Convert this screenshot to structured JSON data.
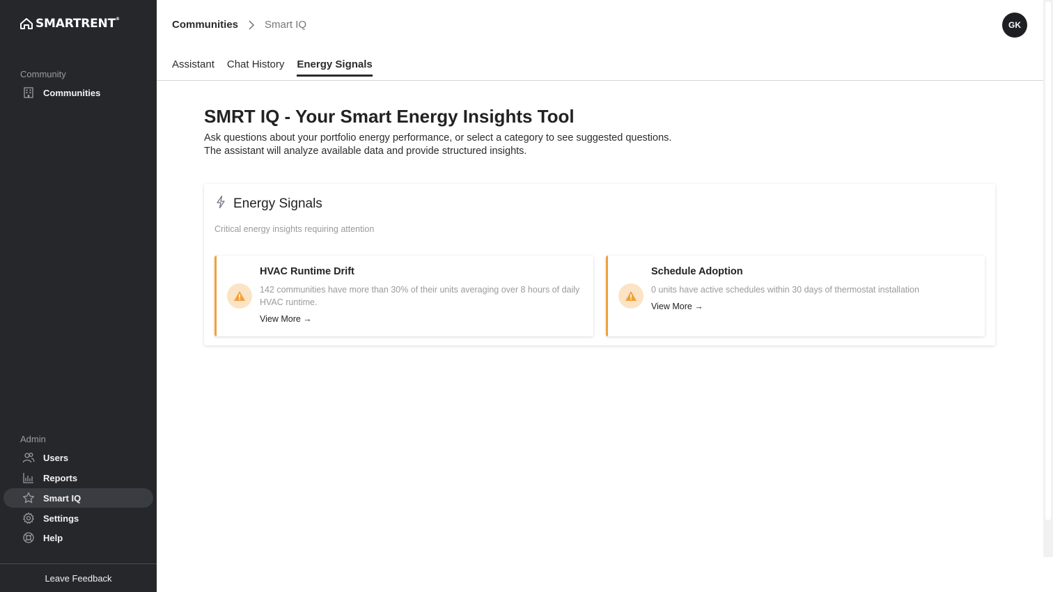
{
  "brand": {
    "name": "SMARTRENT",
    "mark": "®"
  },
  "sidebar": {
    "community_label": "Community",
    "community_items": [
      {
        "label": "Communities",
        "icon": "building-icon"
      }
    ],
    "admin_label": "Admin",
    "admin_items": [
      {
        "label": "Users",
        "icon": "users-icon"
      },
      {
        "label": "Reports",
        "icon": "bar-chart-icon"
      },
      {
        "label": "Smart IQ",
        "icon": "star-icon",
        "active": true
      },
      {
        "label": "Settings",
        "icon": "gear-icon"
      },
      {
        "label": "Help",
        "icon": "lifebuoy-icon"
      }
    ],
    "feedback": "Leave Feedback"
  },
  "header": {
    "breadcrumb": {
      "root": "Communities",
      "current": "Smart IQ"
    },
    "avatar_initials": "GK"
  },
  "tabs": [
    {
      "label": "Assistant",
      "active": false
    },
    {
      "label": "Chat History",
      "active": false
    },
    {
      "label": "Energy Signals",
      "active": true
    }
  ],
  "main": {
    "title": "SMRT IQ - Your Smart Energy Insights Tool",
    "description_line1": "Ask questions about your portfolio energy performance, or select a category to see suggested questions.",
    "description_line2": "The assistant will analyze available data and provide structured insights."
  },
  "panel": {
    "title": "Energy Signals",
    "subtitle": "Critical energy insights requiring attention",
    "cards": [
      {
        "title": "HVAC Runtime Drift",
        "description": "142 communities have more than 30% of their units averaging over 8 hours of daily HVAC runtime.",
        "link": "View More →"
      },
      {
        "title": "Schedule Adoption",
        "description": "0 units have active schedules within 30 days of thermostat installation",
        "link": "View More →"
      }
    ]
  },
  "colors": {
    "sidebar_bg": "#25272b",
    "accent_warning": "#f0a13a",
    "warning_bg": "#fbe3c5"
  }
}
